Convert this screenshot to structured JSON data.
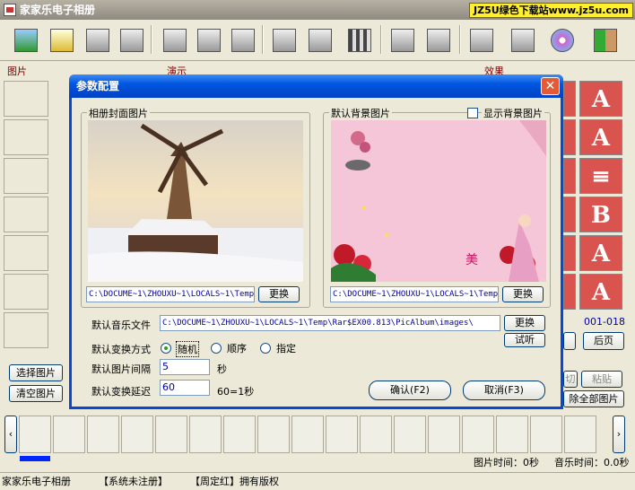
{
  "app": {
    "title": "家家乐电子相册",
    "badge": "JZ5U绿色下载站www.jz5u.com"
  },
  "sections": {
    "pictures": "图片",
    "demo": "演示",
    "effects": "效果"
  },
  "toolbar": {
    "icons": [
      "open-photo-icon",
      "open-folder-icon",
      "save-icon",
      "copy-icon",
      "document-icon",
      "files-icon",
      "delete-icon",
      "edit-image-icon",
      "print-icon",
      "filmstrip-icon",
      "music-icon",
      "camera-icon",
      "search-icon",
      "tools-icon",
      "cd-icon",
      "exit-icon"
    ]
  },
  "effects": {
    "cells": [
      "A",
      "A",
      "≡",
      "B",
      "A",
      "A"
    ],
    "page_range": "001-018",
    "back_page": "后页"
  },
  "left_buttons": {
    "select": "选择图片",
    "clear": "清空图片"
  },
  "right_buttons": {
    "cut": "切",
    "paste": "粘贴",
    "remove_all": "除全部图片"
  },
  "film": {
    "time_label": "图片时间：0秒",
    "music_label": "音乐时间：0.0秒"
  },
  "status": {
    "app": "家家乐电子相册",
    "reg": "【系统未注册】",
    "copyright": "【周定红】拥有版权"
  },
  "dialog": {
    "title": "参数配置",
    "close": "✕",
    "cover_group": "相册封面图片",
    "cover_path": "C:\\DOCUME~1\\ZHOUXU~1\\LOCALS~1\\Temp",
    "bg_group": "默认背景图片",
    "show_bg": "显示背景图片",
    "bg_path": "C:\\DOCUME~1\\ZHOUXU~1\\LOCALS~1\\Temp",
    "change": "更换",
    "music_label": "默认音乐文件",
    "music_path": "C:\\DOCUME~1\\ZHOUXU~1\\LOCALS~1\\Temp\\Rar$EX00.813\\PicAlbum\\images\\",
    "listen": "试听",
    "mode_label": "默认变换方式",
    "mode_random": "随机",
    "mode_sequence": "顺序",
    "mode_specified": "指定",
    "interval_label": "默认图片间隔",
    "interval_value": "5",
    "interval_unit": "秒",
    "delay_label": "默认变换延迟",
    "delay_value": "60",
    "delay_unit": "60=1秒",
    "ok": "确认(F2)",
    "cancel": "取消(F3)"
  },
  "colors": {
    "dialog_blue": "#0a46d8",
    "path_text": "#0000a0",
    "effect_red": "#d9534f"
  }
}
